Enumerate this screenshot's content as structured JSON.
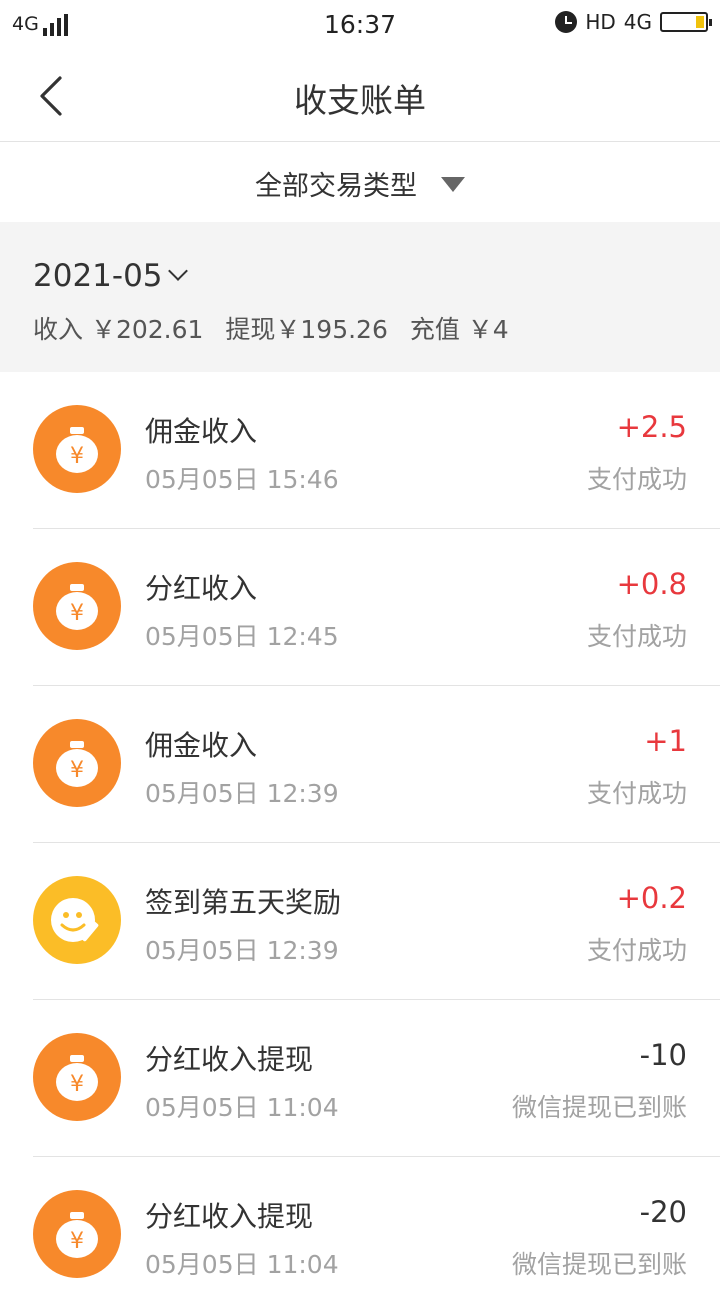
{
  "status_bar": {
    "network": "4G",
    "time": "16:37",
    "hd": "HD",
    "network_right": "4G"
  },
  "header": {
    "title": "收支账单",
    "back_icon": "chevron-left-icon"
  },
  "filter": {
    "label": "全部交易类型",
    "icon": "triangle-down-icon"
  },
  "summary": {
    "month": "2021-05",
    "income": "收入 ￥202.61",
    "withdraw": "提现￥195.26",
    "recharge": "充值 ￥4"
  },
  "colors": {
    "positive_amount": "#e8383d",
    "icon_orange": "#f7892b",
    "icon_yellow": "#fbbd27",
    "summary_bg": "#f4f4f4"
  },
  "transactions": [
    {
      "title": "佣金收入",
      "time": "05月05日 15:46",
      "amount": "+2.5",
      "status": "支付成功",
      "icon": "money-bag-icon"
    },
    {
      "title": "分红收入",
      "time": "05月05日 12:45",
      "amount": "+0.8",
      "status": "支付成功",
      "icon": "money-bag-icon"
    },
    {
      "title": "佣金收入",
      "time": "05月05日 12:39",
      "amount": "+1",
      "status": "支付成功",
      "icon": "money-bag-icon"
    },
    {
      "title": "签到第五天奖励",
      "time": "05月05日 12:39",
      "amount": "+0.2",
      "status": "支付成功",
      "icon": "smiley-pen-icon"
    },
    {
      "title": "分红收入提现",
      "time": "05月05日 11:04",
      "amount": "-10",
      "status": "微信提现已到账",
      "icon": "money-bag-icon"
    },
    {
      "title": "分红收入提现",
      "time": "05月05日 11:04",
      "amount": "-20",
      "status": "微信提现已到账",
      "icon": "money-bag-icon"
    }
  ]
}
